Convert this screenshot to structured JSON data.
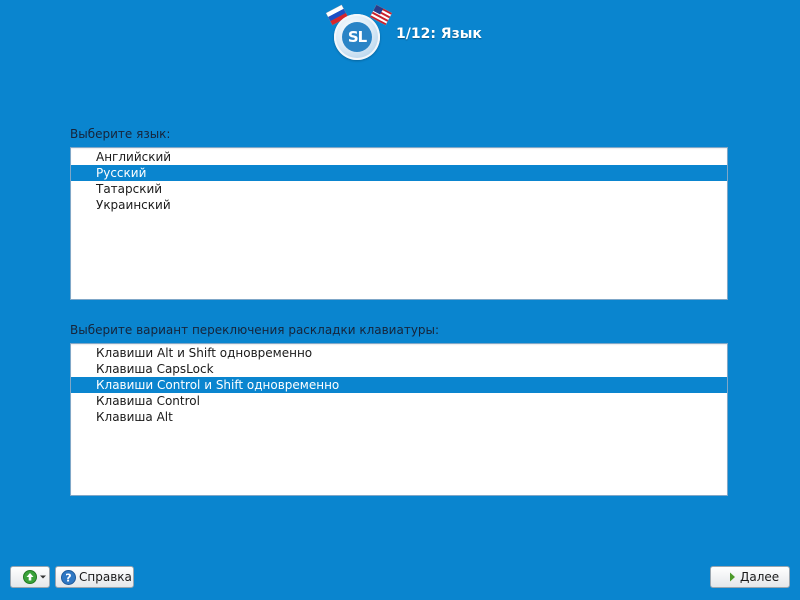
{
  "header": {
    "title": "1/12: Язык",
    "logo_text": "SL"
  },
  "language_section": {
    "label": "Выберите язык:",
    "items": [
      {
        "label": "Английский",
        "selected": false
      },
      {
        "label": "Русский",
        "selected": true
      },
      {
        "label": "Татарский",
        "selected": false
      },
      {
        "label": "Украинский",
        "selected": false
      }
    ]
  },
  "keyboard_section": {
    "label": "Выберите вариант переключения раскладки клавиатуры:",
    "items": [
      {
        "label": "Клавиши Alt и Shift одновременно",
        "selected": false
      },
      {
        "label": "Клавиша CapsLock",
        "selected": false
      },
      {
        "label": "Клавиши Control и Shift одновременно",
        "selected": true
      },
      {
        "label": "Клавиша Control",
        "selected": false
      },
      {
        "label": "Клавиша Alt",
        "selected": false
      }
    ]
  },
  "buttons": {
    "add_icon": "green-up-arrow-icon",
    "help_label": "Справка",
    "help_icon": "question-icon",
    "next_label": "Далее",
    "next_icon": "chevron-right-icon"
  },
  "colors": {
    "background": "#0a85cf",
    "selection": "#0a85cf",
    "list_background": "#ffffff"
  }
}
